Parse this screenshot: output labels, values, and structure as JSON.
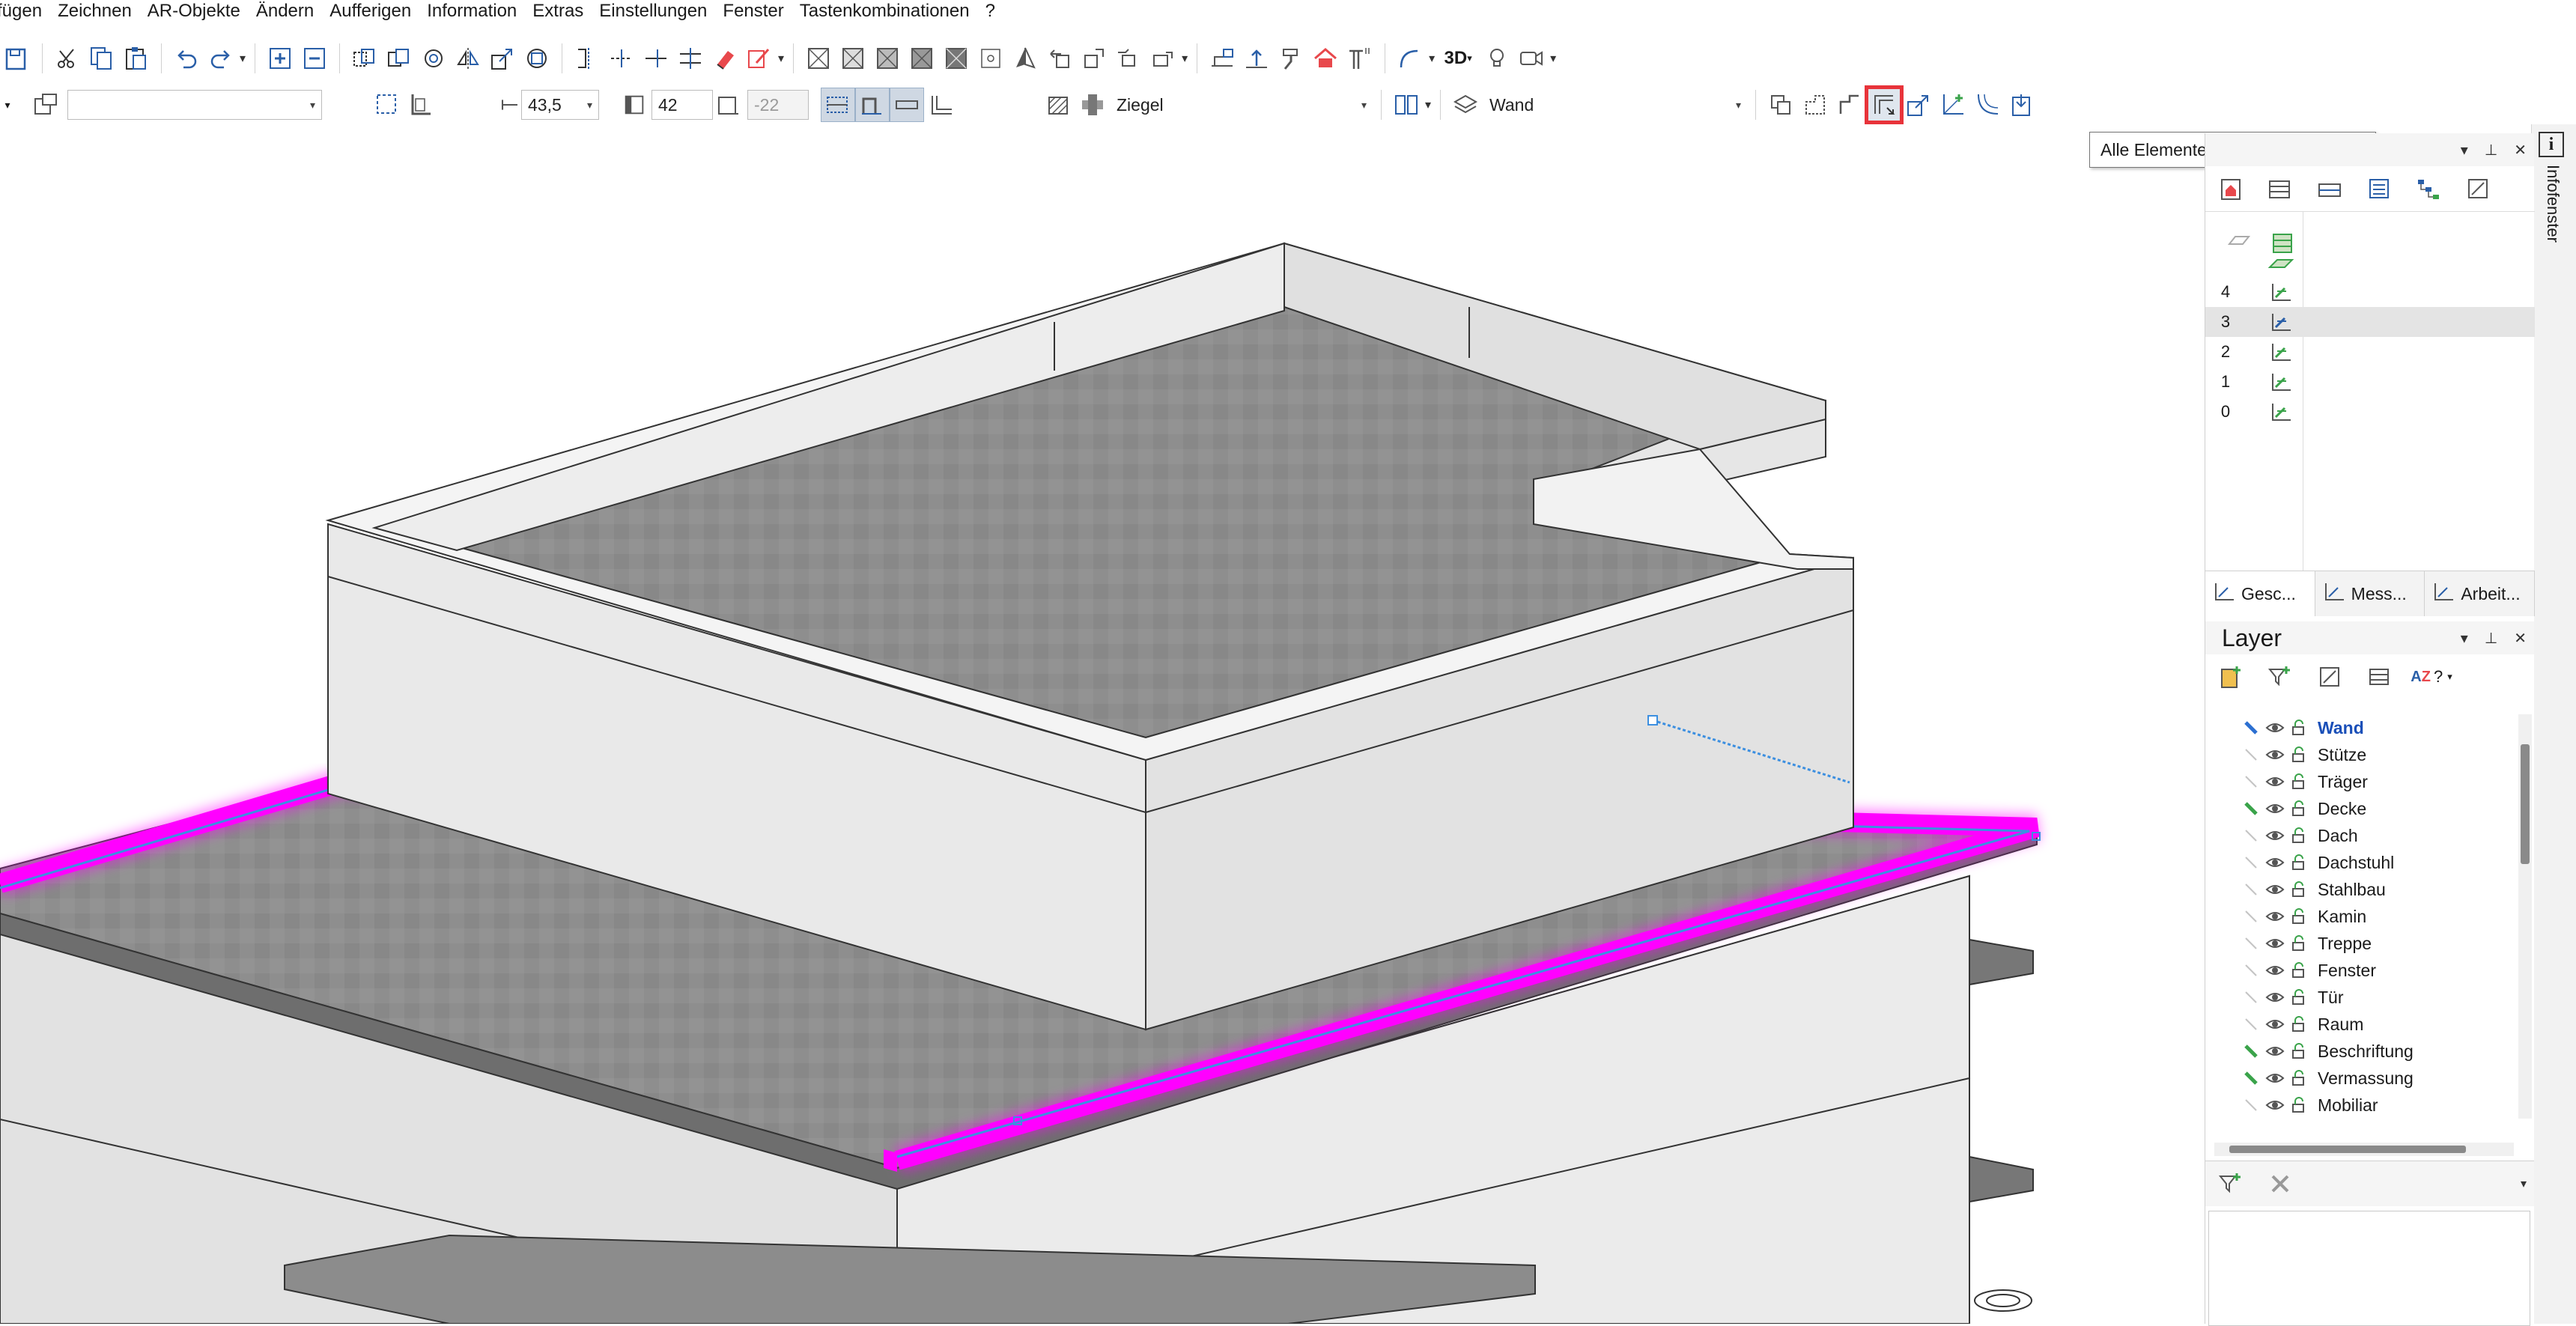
{
  "menu": [
    "fügen",
    "Zeichnen",
    "AR-Objekte",
    "Ändern",
    "Aufferigen",
    "Information",
    "Extras",
    "Einstellungen",
    "Fenster",
    "Tastenkombinationen",
    "?"
  ],
  "toolbar2": {
    "thickness_value": "43,5",
    "height_value": "42",
    "offset_value": "-22",
    "material_value": "Ziegel",
    "layer_value": "Wand",
    "empty_combo": ""
  },
  "toolbar1": {
    "view3d_label": "3D"
  },
  "tooltip": "Alle Elemente parallel verschieben",
  "infofenster": {
    "label": "Infofenster"
  },
  "project_panel": {
    "floors": [
      {
        "num": "",
        "icon": "roof-floor-icon"
      },
      {
        "num": "4",
        "icon": "floor-icon"
      },
      {
        "num": "3",
        "icon": "floor-active-icon",
        "selected": true
      },
      {
        "num": "2",
        "icon": "floor-icon"
      },
      {
        "num": "1",
        "icon": "floor-icon"
      },
      {
        "num": "0",
        "icon": "floor-icon"
      }
    ],
    "tabs": [
      "Gesc...",
      "Mess...",
      "Arbeit..."
    ]
  },
  "layer_panel": {
    "title": "Layer",
    "layers": [
      {
        "name": "Wand",
        "active": true,
        "color": "#2c6fd1"
      },
      {
        "name": "Stütze",
        "active": false,
        "color": ""
      },
      {
        "name": "Träger",
        "active": false,
        "color": ""
      },
      {
        "name": "Decke",
        "active": false,
        "color": "#3aa34a"
      },
      {
        "name": "Dach",
        "active": false,
        "color": ""
      },
      {
        "name": "Dachstuhl",
        "active": false,
        "color": ""
      },
      {
        "name": "Stahlbau",
        "active": false,
        "color": ""
      },
      {
        "name": "Kamin",
        "active": false,
        "color": ""
      },
      {
        "name": "Treppe",
        "active": false,
        "color": ""
      },
      {
        "name": "Fenster",
        "active": false,
        "color": ""
      },
      {
        "name": "Tür",
        "active": false,
        "color": ""
      },
      {
        "name": "Raum",
        "active": false,
        "color": ""
      },
      {
        "name": "Beschriftung",
        "active": false,
        "color": "#3aa34a"
      },
      {
        "name": "Vermassung",
        "active": false,
        "color": "#3aa34a"
      },
      {
        "name": "Mobiliar",
        "active": false,
        "color": ""
      }
    ]
  },
  "colors": {
    "selection": "#ff00ff",
    "selection_edge": "#3c8fe0",
    "floor_gray": "#8c8c8c",
    "wall_face": "#eeeeee",
    "highlight": "#e8333a"
  }
}
